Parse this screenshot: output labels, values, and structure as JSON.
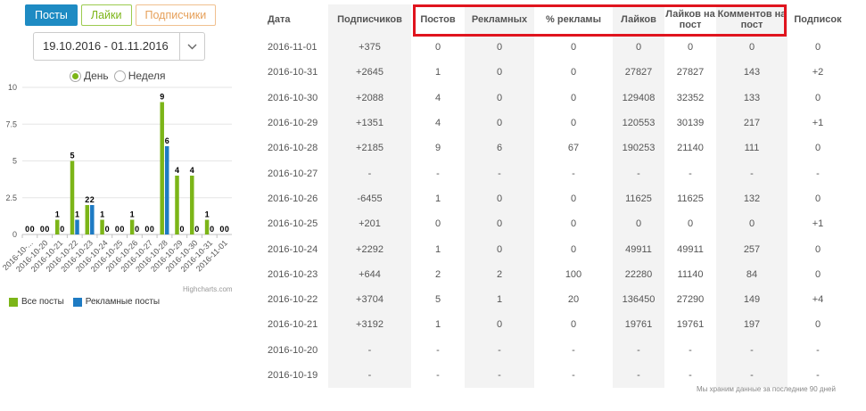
{
  "tabs": [
    {
      "label": "Посты",
      "active": true
    },
    {
      "label": "Лайки",
      "active": false
    },
    {
      "label": "Подписчики",
      "active": false
    }
  ],
  "daterange": {
    "value": "19.10.2016 - 01.11.2016"
  },
  "radios": [
    {
      "label": "День",
      "checked": true
    },
    {
      "label": "Неделя",
      "checked": false
    }
  ],
  "legend": {
    "all_posts": "Все посты",
    "ad_posts": "Рекламные посты"
  },
  "credit": "Highcharts.com",
  "colors": {
    "green": "#7cb518",
    "blue": "#1e7bc3",
    "red": "#e04a4a",
    "highlight": "#e0141e"
  },
  "chart_data": {
    "type": "bar",
    "categories": [
      "2016-10-...",
      "2016-10-20",
      "2016-10-21",
      "2016-10-22",
      "2016-10-23",
      "2016-10-24",
      "2016-10-25",
      "2016-10-26",
      "2016-10-27",
      "2016-10-28",
      "2016-10-29",
      "2016-10-30",
      "2016-10-31",
      "2016-11-01"
    ],
    "series": [
      {
        "name": "Все посты",
        "values": [
          0,
          0,
          1,
          5,
          2,
          1,
          0,
          1,
          0,
          9,
          4,
          4,
          1,
          0
        ]
      },
      {
        "name": "Рекламные посты",
        "values": [
          0,
          0,
          0,
          1,
          2,
          0,
          0,
          0,
          0,
          6,
          0,
          0,
          0,
          0
        ]
      }
    ],
    "yticks": [
      "0",
      "2.5",
      "5",
      "7.5",
      "10"
    ],
    "ylim": [
      0,
      10
    ],
    "grid": true,
    "legend": "bottom-left"
  },
  "table": {
    "headers": [
      "Дата",
      "Подписчиков",
      "Постов",
      "Рекламных",
      "% рекламы",
      "Лайков",
      "Лайков на пост",
      "Комментов на пост",
      "Подписок"
    ],
    "rows": [
      [
        "2016-11-01",
        "+375",
        "0",
        "0",
        "0",
        "0",
        "0",
        "0",
        "0"
      ],
      [
        "2016-10-31",
        "+2645",
        "1",
        "0",
        "0",
        "27827",
        "27827",
        "143",
        "+2"
      ],
      [
        "2016-10-30",
        "+2088",
        "4",
        "0",
        "0",
        "129408",
        "32352",
        "133",
        "0"
      ],
      [
        "2016-10-29",
        "+1351",
        "4",
        "0",
        "0",
        "120553",
        "30139",
        "217",
        "+1"
      ],
      [
        "2016-10-28",
        "+2185",
        "9",
        "6",
        "67",
        "190253",
        "21140",
        "111",
        "0"
      ],
      [
        "2016-10-27",
        "-",
        "-",
        "-",
        "-",
        "-",
        "-",
        "-",
        "-"
      ],
      [
        "2016-10-26",
        "-6455",
        "1",
        "0",
        "0",
        "11625",
        "11625",
        "132",
        "0"
      ],
      [
        "2016-10-25",
        "+201",
        "0",
        "0",
        "0",
        "0",
        "0",
        "0",
        "+1"
      ],
      [
        "2016-10-24",
        "+2292",
        "1",
        "0",
        "0",
        "49911",
        "49911",
        "257",
        "0"
      ],
      [
        "2016-10-23",
        "+644",
        "2",
        "2",
        "100",
        "22280",
        "11140",
        "84",
        "0"
      ],
      [
        "2016-10-22",
        "+3704",
        "5",
        "1",
        "20",
        "136450",
        "27290",
        "149",
        "+4"
      ],
      [
        "2016-10-21",
        "+3192",
        "1",
        "0",
        "0",
        "19761",
        "19761",
        "197",
        "0"
      ],
      [
        "2016-10-20",
        "-",
        "-",
        "-",
        "-",
        "-",
        "-",
        "-",
        "-"
      ],
      [
        "2016-10-19",
        "-",
        "-",
        "-",
        "-",
        "-",
        "-",
        "-",
        "-"
      ]
    ]
  },
  "note": "Мы храним данные за последние 90 дней"
}
